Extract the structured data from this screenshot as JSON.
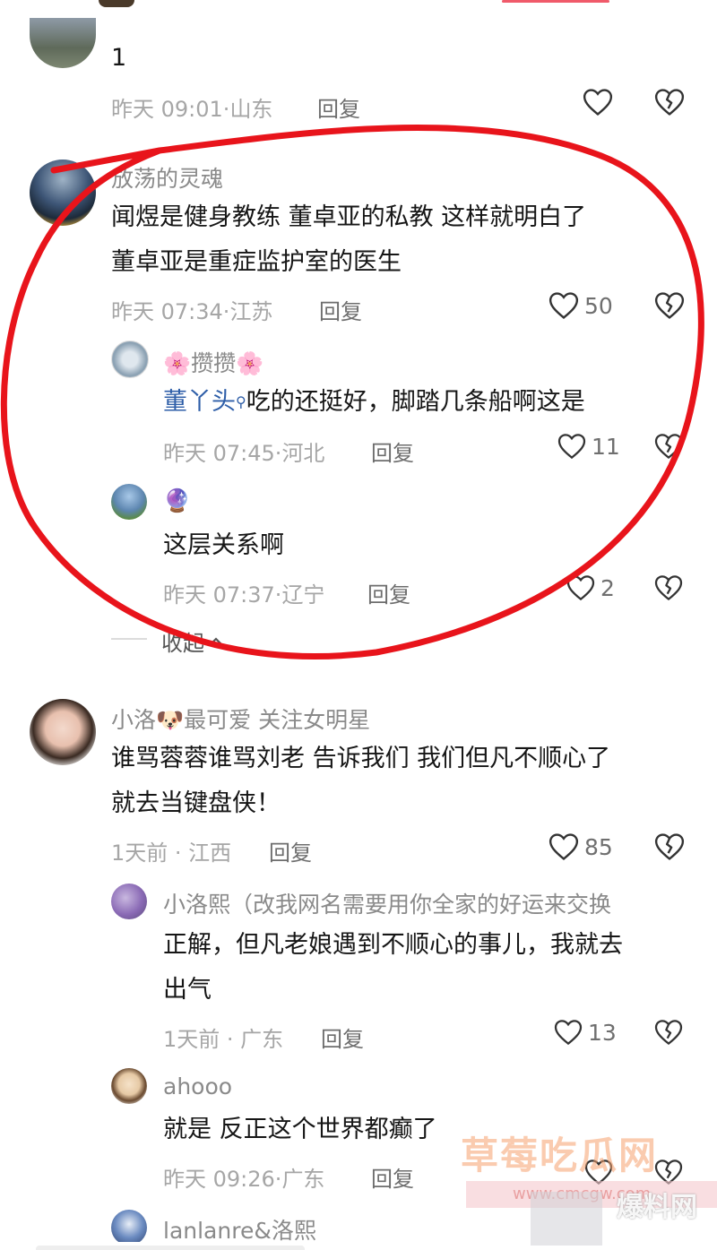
{
  "comments": [
    {
      "text": "1",
      "time": "昨天 09:01",
      "location": "山东",
      "reply_label": "回复",
      "likes": ""
    },
    {
      "name": "放荡的灵魂",
      "line1": "闻煜是健身教练 董卓亚的私教 这样就明白了",
      "line2": "董卓亚是重症监护室的医生",
      "time": "昨天 07:34",
      "location": "江苏",
      "reply_label": "回复",
      "likes": "50",
      "replies": [
        {
          "name": "🌸攒攒🌸",
          "mention": "董丫头",
          "text": "吃的还挺好，脚踏几条船啊这是",
          "time": "昨天 07:45",
          "location": "河北",
          "reply_label": "回复",
          "likes": "11"
        },
        {
          "name": "🔮",
          "text": "这层关系啊",
          "time": "昨天 07:37",
          "location": "辽宁",
          "reply_label": "回复",
          "likes": "2"
        }
      ],
      "collapse_label": "收起"
    },
    {
      "name": "小洛🐶最可爱 关注女明星",
      "line1": "谁骂蓉蓉谁骂刘老 告诉我们 我们但凡不顺心了",
      "line2": "就去当键盘侠！",
      "time": "1天前",
      "location": "江西",
      "reply_label": "回复",
      "likes": "85",
      "replies": [
        {
          "name": "小洛熙（改我网名需要用你全家的好运来交换",
          "line1": "正解，但凡老娘遇到不顺心的事儿，我就去",
          "line2": "出气",
          "time": "1天前",
          "location": "广东",
          "reply_label": "回复",
          "likes": "13"
        },
        {
          "name": "ahooo",
          "text": "就是 反正这个世界都癫了",
          "time": "昨天 09:26",
          "location": "广东",
          "reply_label": "回复",
          "likes": ""
        },
        {
          "name": "lanlanre&洛熙"
        }
      ]
    }
  ],
  "watermark": {
    "main": "草莓吃瓜网",
    "url": "www.cmcgw.com",
    "tag": "爆料网"
  },
  "colors": {
    "annotation_circle": "#e8141b",
    "mention": "#2e5ea8",
    "meta": "#a6a6a6"
  }
}
